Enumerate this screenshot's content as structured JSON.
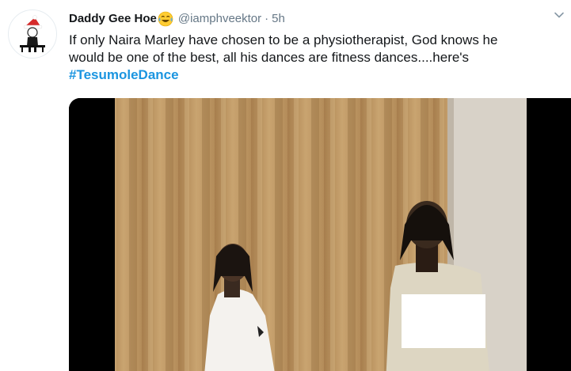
{
  "tweet": {
    "author_name": "Daddy Gee Hoe",
    "author_emoji": "face-with-tears-of-joy-emoji",
    "handle": "@iamphveektor",
    "separator": "·",
    "time": "5h",
    "text_line1": "If only Naira Marley have chosen to be a physiotherapist, God knows he",
    "text_line2": "would be one of the best, all his dances are fitness dances....here's",
    "hashtag": "#TesumoleDance"
  },
  "icons": {
    "caret": "chevron-down-icon",
    "avatar": "santa-hat-character-avatar"
  },
  "colors": {
    "hashtag": "#1b95e0",
    "text": "#14171a",
    "muted": "#657786",
    "curtain": "#c29c69"
  }
}
